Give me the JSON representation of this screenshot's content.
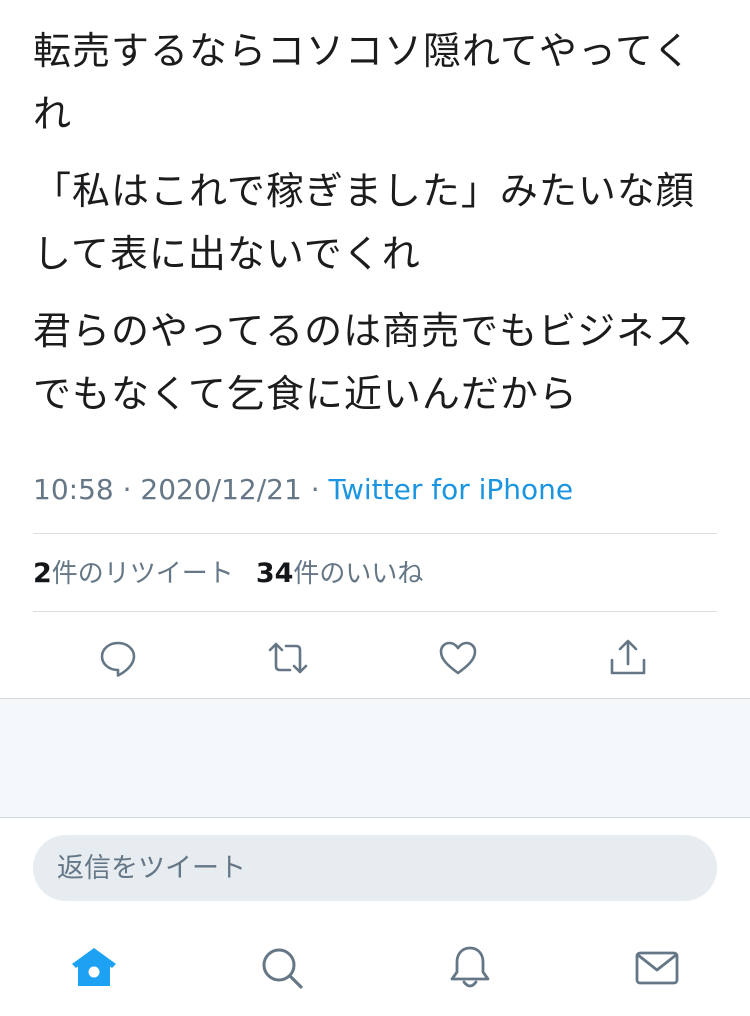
{
  "tweet": {
    "paragraphs": [
      "転売するならコソコソ隠れてやってくれ",
      "「私はこれで稼ぎました」みたいな顔して表に出ないでくれ",
      "君らのやってるのは商売でもビジネスでもなくて乞食に近いんだから"
    ],
    "time": "10:58",
    "separator1": " · ",
    "date": "2020/12/21",
    "separator2": " · ",
    "source": "Twitter for iPhone"
  },
  "stats": {
    "retweet_count": "2",
    "retweet_label": "件のリツイート",
    "like_count": "34",
    "like_label": "件のいいね"
  },
  "actions": {
    "icons": [
      "reply-icon",
      "retweet-icon",
      "like-icon",
      "share-icon"
    ]
  },
  "reply": {
    "placeholder": "返信をツイート"
  },
  "tabbar": {
    "icons": [
      "home-icon",
      "search-icon",
      "notifications-icon",
      "messages-icon"
    ],
    "active": "home-icon"
  },
  "colors": {
    "text": "#1c1c1e",
    "muted": "#657786",
    "accent": "#1b95e0",
    "tab_active": "#1da1f2",
    "icon_grey": "#657786"
  }
}
